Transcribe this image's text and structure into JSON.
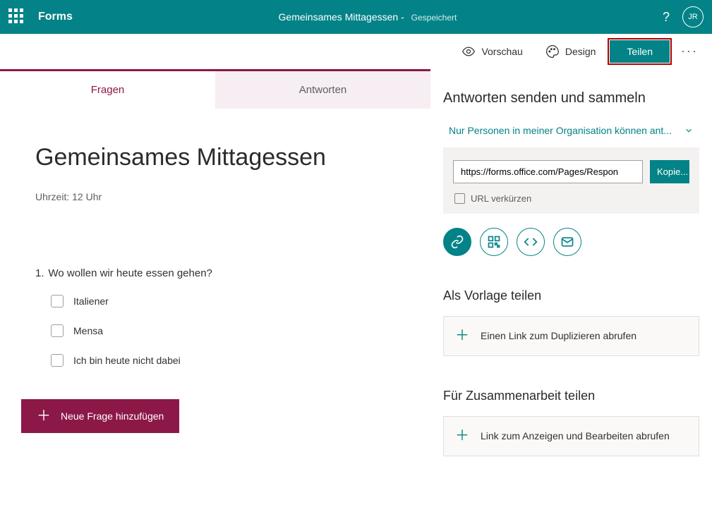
{
  "header": {
    "app": "Forms",
    "doc": "Gemeinsames Mittagessen",
    "sep": " - ",
    "status": "Gespeichert",
    "initials": "JR"
  },
  "toolbar": {
    "preview": "Vorschau",
    "design": "Design",
    "share": "Teilen"
  },
  "tabs": {
    "questions": "Fragen",
    "answers": "Antworten"
  },
  "form": {
    "title": "Gemeinsames Mittagessen",
    "subtitle": "Uhrzeit: 12 Uhr",
    "q_num": "1.",
    "q_text": "Wo wollen wir heute essen gehen?",
    "options": [
      "Italiener",
      "Mensa",
      "Ich bin heute nicht dabei"
    ],
    "add": "Neue Frage hinzufügen"
  },
  "share": {
    "title": "Antworten senden und sammeln",
    "permission": "Nur Personen in meiner Organisation können ant...",
    "url": "https://forms.office.com/Pages/Respon",
    "copy": "Kopie...",
    "shorten": "URL verkürzen",
    "template_title": "Als Vorlage teilen",
    "template_btn": "Einen Link zum Duplizieren abrufen",
    "collab_title": "Für Zusammenarbeit teilen",
    "collab_btn": "Link zum Anzeigen und Bearbeiten abrufen"
  }
}
